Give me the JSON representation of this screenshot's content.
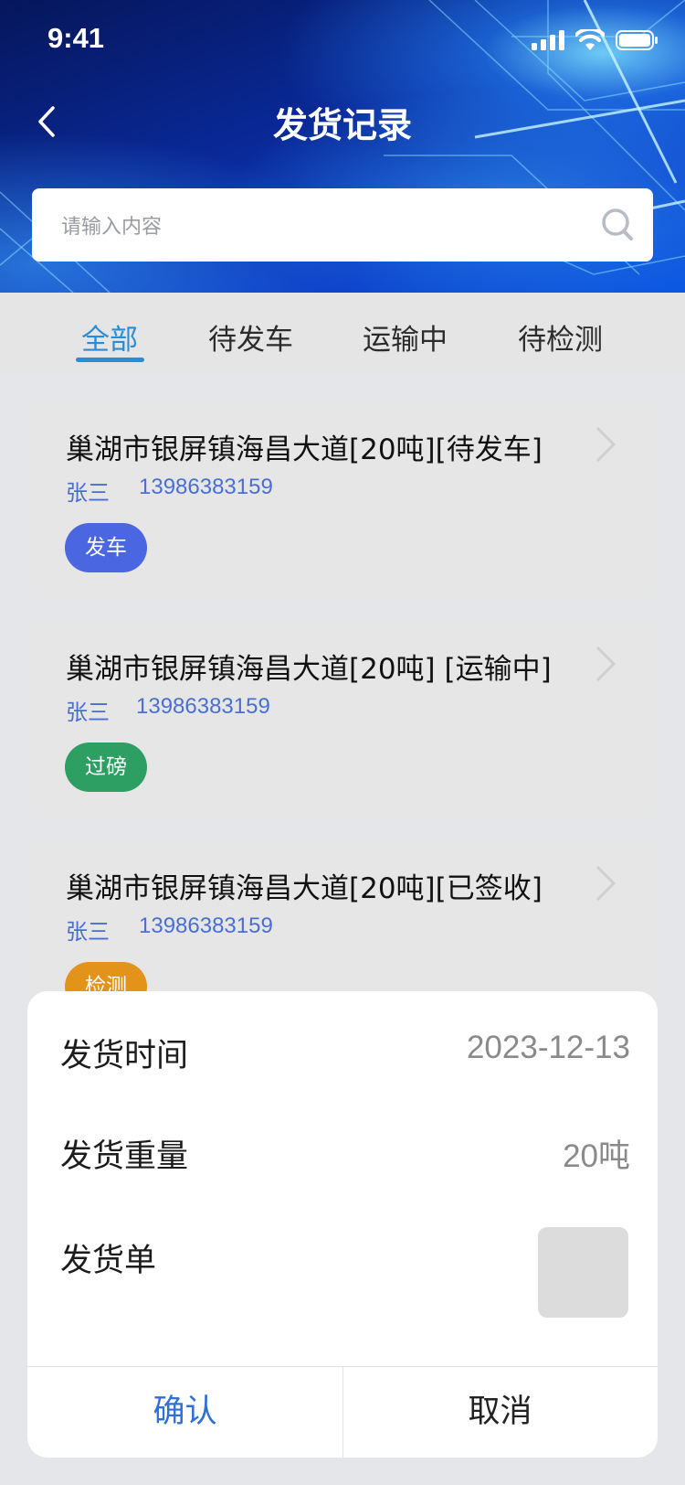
{
  "status_bar": {
    "time": "9:41"
  },
  "header": {
    "title": "发货记录"
  },
  "search": {
    "placeholder": "请输入内容"
  },
  "tabs": [
    {
      "label": "全部",
      "active": true
    },
    {
      "label": "待发车",
      "active": false
    },
    {
      "label": "运输中",
      "active": false
    },
    {
      "label": "待检测",
      "active": false
    }
  ],
  "records": [
    {
      "title": "巢湖市银屏镇海昌大道[20吨][待发车]",
      "name": "张三",
      "phone": "13986383159",
      "action": "发车",
      "action_color": "#4a66e0"
    },
    {
      "title": "巢湖市银屏镇海昌大道[20吨] [运输中]",
      "name": "张三",
      "phone": "13986383159",
      "action": "过磅",
      "action_color": "#2e9f62"
    },
    {
      "title": "巢湖市银屏镇海昌大道[20吨][已签收]",
      "name": "张三",
      "phone": "13986383159",
      "action": "检测",
      "action_color": "#e3921a"
    }
  ],
  "sheet": {
    "rows": [
      {
        "label": "发货时间",
        "value": "2023-12-13"
      },
      {
        "label": "发货重量",
        "value": "20吨"
      },
      {
        "label": "发货单",
        "value": ""
      }
    ],
    "confirm_label": "确认",
    "cancel_label": "取消"
  },
  "colors": {
    "accent": "#2b8cd6",
    "link_blue": "#4a6fd2",
    "confirm_blue": "#2f6fd6",
    "overlay": "rgba(0,0,0,0.04)"
  }
}
